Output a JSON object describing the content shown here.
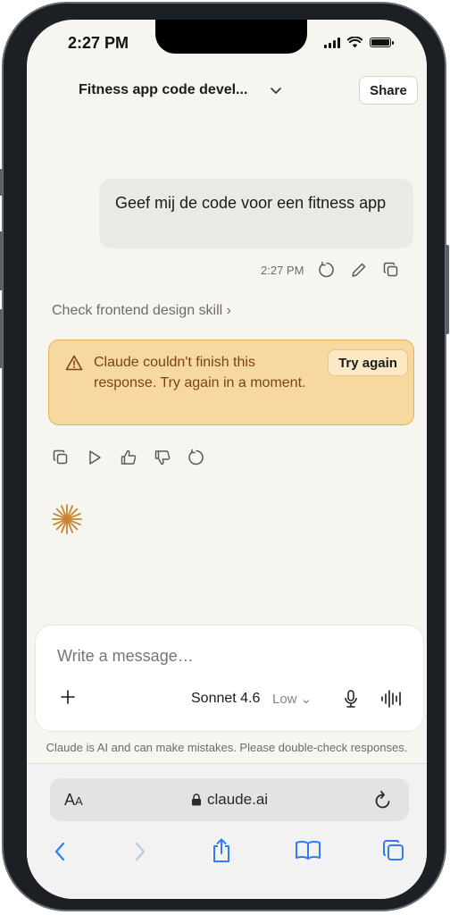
{
  "status_bar": {
    "time": "2:27 PM"
  },
  "header": {
    "title": "Fitness app code devel...",
    "share_label": "Share"
  },
  "user_message": {
    "text": "Geef mij de code voor een fitness app",
    "time": "2:27 PM"
  },
  "skill_link": {
    "label": "Check frontend design skill",
    "chevron": "›"
  },
  "error": {
    "message": "Claude couldn't finish this response. Try again in a moment.",
    "retry_label": "Try again"
  },
  "composer": {
    "placeholder": "Write a message…",
    "model": "Sonnet 4.6",
    "effort": "Low ⌄"
  },
  "disclaimer": "Claude is AI and can make mistakes. Please double-check responses.",
  "browser": {
    "url": "claude.ai",
    "aa_large": "A",
    "aa_small": "A"
  },
  "colors": {
    "error_bg": "#f7d9a0",
    "error_border": "#e1b25c",
    "error_text": "#7a4410",
    "spark": "#c9832d",
    "safari_blue": "#2f7cf6"
  },
  "icons": [
    "regenerate-icon",
    "edit-icon",
    "copy-icon",
    "warning-icon",
    "play-icon",
    "thumbs-up-icon",
    "thumbs-down-icon",
    "spark-icon",
    "plus-icon",
    "microphone-icon",
    "voice-icon",
    "lock-icon",
    "reload-icon",
    "back-icon",
    "forward-icon",
    "share-icon",
    "bookmarks-icon",
    "tabs-icon"
  ]
}
